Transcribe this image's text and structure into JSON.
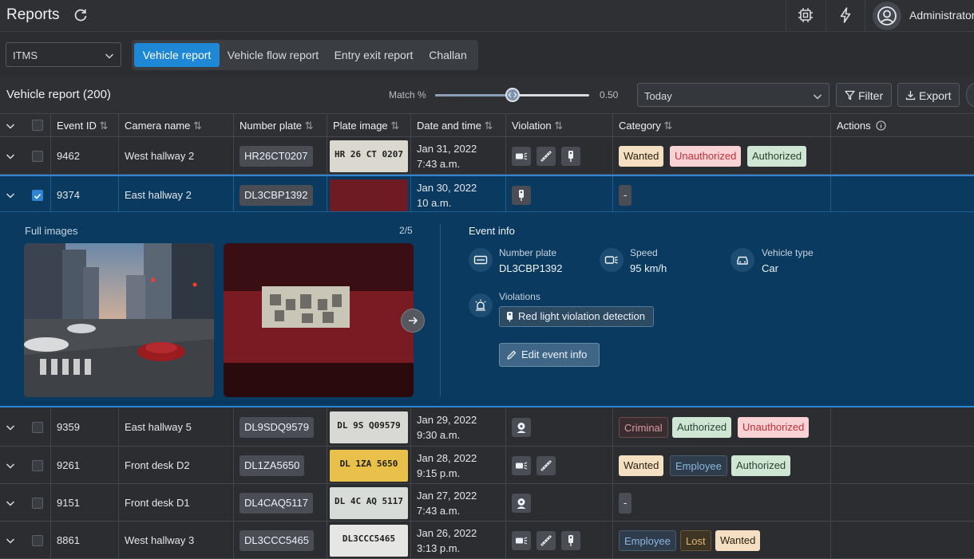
{
  "app": {
    "title": "Reports",
    "user": "Administrator"
  },
  "system_select": {
    "value": "ITMS"
  },
  "tabs": [
    {
      "label": "Vehicle report",
      "active": true
    },
    {
      "label": "Vehicle flow report",
      "active": false
    },
    {
      "label": "Entry exit report",
      "active": false
    },
    {
      "label": "Challan",
      "active": false
    }
  ],
  "subheader": {
    "title": "Vehicle report (200)",
    "match_label": "Match %",
    "match_value": "0.50",
    "match_fraction": 0.5,
    "date_select": "Today",
    "filter_label": "Filter",
    "export_label": "Export"
  },
  "columns": [
    "Event ID",
    "Camera name",
    "Number plate",
    "Plate image",
    "Date and time",
    "Violation",
    "Category",
    "Actions"
  ],
  "rows": [
    {
      "event_id": "9462",
      "camera": "West hallway 2",
      "plate": "HR26CT0207",
      "plate_image_text": "HR 26 CT 0207",
      "date": "Jan 31, 2022",
      "time": "7:43 a.m.",
      "violations": [
        "speed",
        "seatbelt",
        "redlight"
      ],
      "categories": [
        {
          "label": "Wanted",
          "type": "wanted"
        },
        {
          "label": "Unauthorized",
          "type": "unauth"
        },
        {
          "label": "Authorized",
          "type": "auth"
        }
      ],
      "selected": false
    },
    {
      "event_id": "9374",
      "camera": "East hallway 2",
      "plate": "DL3CBP1392",
      "plate_image_text": "",
      "date": "Jan 30, 2022",
      "time": "10 a.m.",
      "violations": [
        "redlight"
      ],
      "categories": [
        {
          "label": "-",
          "type": "none"
        }
      ],
      "selected": true
    },
    {
      "event_id": "9359",
      "camera": "East hallway 5",
      "plate": "DL9SDQ9579",
      "plate_image_text": "DL 9S Q09579",
      "date": "Jan 29, 2022",
      "time": "9:30 a.m.",
      "violations": [
        "driver"
      ],
      "categories": [
        {
          "label": "Criminal",
          "type": "criminal"
        },
        {
          "label": "Authorized",
          "type": "auth"
        },
        {
          "label": "Unauthorized",
          "type": "unauth"
        }
      ],
      "selected": false
    },
    {
      "event_id": "9261",
      "camera": "Front desk D2",
      "plate": "DL1ZA5650",
      "plate_image_text": "DL 1ZA 5650",
      "date": "Jan 28, 2022",
      "time": "9:15 p.m.",
      "violations": [
        "speed",
        "seatbelt"
      ],
      "categories": [
        {
          "label": "Wanted",
          "type": "wanted"
        },
        {
          "label": "Employee",
          "type": "employee"
        },
        {
          "label": "Authorized",
          "type": "auth"
        }
      ],
      "selected": false
    },
    {
      "event_id": "9151",
      "camera": "Front desk D1",
      "plate": "DL4CAQ5117",
      "plate_image_text": "DL 4C AQ 5117",
      "date": "Jan 27, 2022",
      "time": "7:43 a.m.",
      "violations": [
        "driver"
      ],
      "categories": [
        {
          "label": "-",
          "type": "none"
        }
      ],
      "selected": false
    },
    {
      "event_id": "8861",
      "camera": "West hallway 3",
      "plate": "DL3CCC5465",
      "plate_image_text": "DL3CCC5465",
      "date": "Jan 26, 2022",
      "time": "3:13 p.m.",
      "violations": [
        "speed",
        "seatbelt",
        "redlight"
      ],
      "categories": [
        {
          "label": "Employee",
          "type": "employee"
        },
        {
          "label": "Lost",
          "type": "lost"
        },
        {
          "label": "Wanted",
          "type": "wanted"
        }
      ],
      "selected": false
    }
  ],
  "expanded": {
    "full_images_label": "Full images",
    "counter": "2/5",
    "event_info_label": "Event info",
    "number_plate_label": "Number plate",
    "number_plate_value": "DL3CBP1392",
    "speed_label": "Speed",
    "speed_value": "95 km/h",
    "vehicle_type_label": "Vehicle type",
    "vehicle_type_value": "Car",
    "violations_label": "Violations",
    "violation_chip": "Red light violation detection",
    "edit_label": "Edit event info"
  },
  "colors": {
    "accent": "#1f88d6",
    "selected_row": "#0a3a5f",
    "background": "#2b2d31"
  }
}
